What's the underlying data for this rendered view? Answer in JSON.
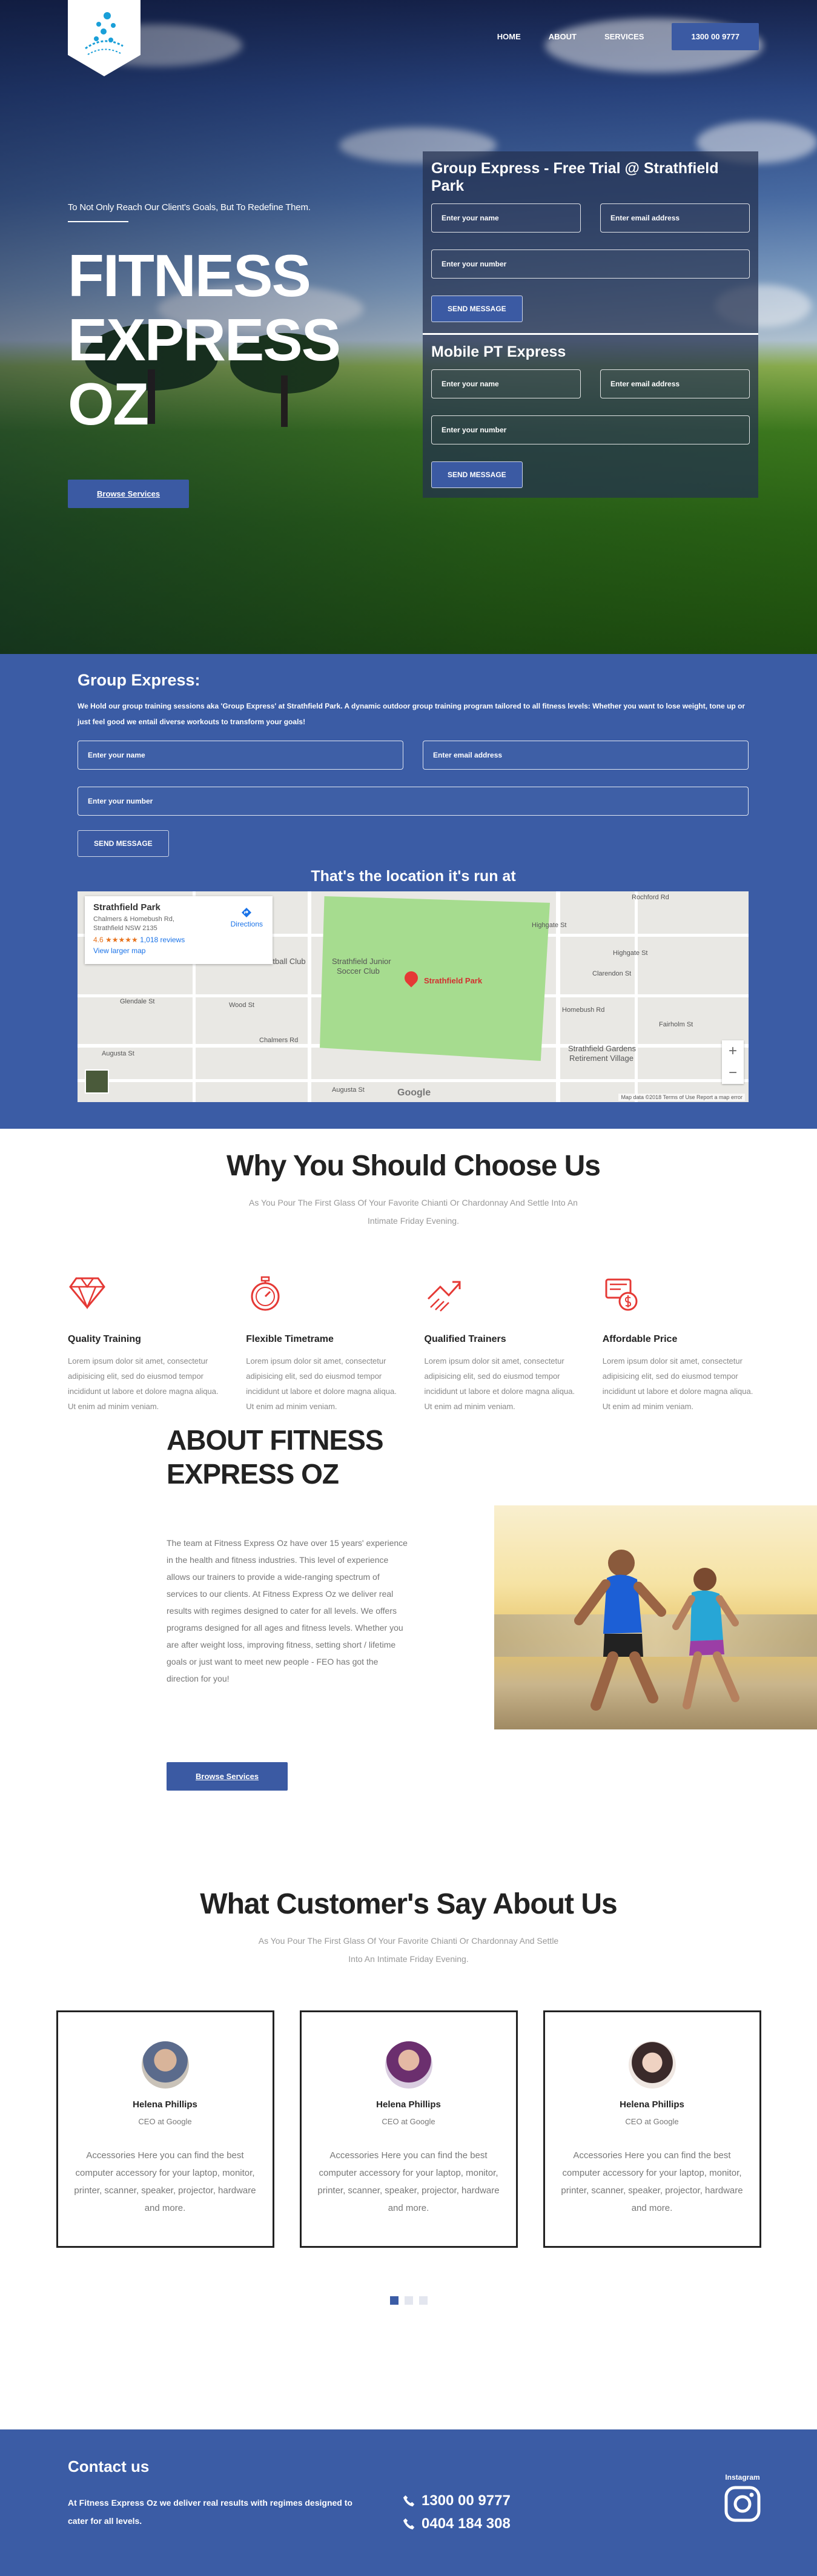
{
  "nav": {
    "home": "HOME",
    "about": "ABOUT",
    "services": "SERVICES",
    "phone": "1300 00 9777"
  },
  "hero": {
    "tagline": "To Not Only Reach Our Client's Goals, But To Redefine Them.",
    "title_line1": "FITNESS",
    "title_line2": "EXPRESS OZ",
    "button": "Browse Services"
  },
  "free_trial_form": {
    "title": "Group Express - Free Trial @ Strathfield Park",
    "name_placeholder": "Enter your name",
    "email_placeholder": "Enter email address",
    "number_placeholder": "Enter your number",
    "submit": "SEND MESSAGE"
  },
  "mobile_pt_form": {
    "title": "Mobile PT Express",
    "name_placeholder": "Enter your name",
    "email_placeholder": "Enter email address",
    "number_placeholder": "Enter your number",
    "submit": "SEND MESSAGE"
  },
  "group_express": {
    "heading": "Group Express:",
    "description": "We Hold our group training sessions aka 'Group Express' at Strathfield Park. A dynamic outdoor group training program tailored to all fitness levels: Whether you want to lose weight, tone up or just feel good we entail diverse workouts to transform your goals!",
    "name_placeholder": "Enter your name",
    "email_placeholder": "Enter email address",
    "number_placeholder": "Enter your number",
    "submit": "SEND MESSAGE",
    "map_title": "That's the location it's run at"
  },
  "map": {
    "place": "Strathfield Park",
    "address_line1": "Chalmers & Homebush Rd,",
    "address_line2": "Strathfield NSW 2135",
    "rating": "4.6 ★★★★★",
    "reviews": "1,018 reviews",
    "larger_map": "View larger map",
    "directions": "Directions",
    "label_club": "Football Club",
    "label_soccer_1": "Strathfield Junior",
    "label_soccer_2": "Soccer Club",
    "label_park": "Strathfield Park",
    "label_village_1": "Strathfield Gardens",
    "label_village_2": "Retirement Village",
    "street_1": "Rochford Rd",
    "street_2": "Highgate St",
    "street_3": "Homebush Rd",
    "street_4": "Augusta St",
    "street_5": "Fairholm St",
    "street_6": "Chalmers Rd",
    "street_7": "Wood St",
    "street_8": "Glendale St",
    "street_9": "Clarendon St",
    "google": "Google",
    "footer": "Map data ©2018   Terms of Use   Report a map error"
  },
  "why": {
    "title": "Why You Should Choose Us",
    "subtitle": "As You Pour The First Glass Of Your Favorite Chianti Or Chardonnay And Settle Into An Intimate Friday Evening.",
    "features": [
      {
        "title": "Quality Training",
        "text": "Lorem ipsum dolor sit amet, consectetur adipisicing elit, sed do eiusmod tempor incididunt ut labore et dolore magna aliqua. Ut enim ad minim veniam."
      },
      {
        "title": "Flexible Timetrame",
        "text": "Lorem ipsum dolor sit amet, consectetur adipisicing elit, sed do eiusmod tempor incididunt ut labore et dolore magna aliqua. Ut enim ad minim veniam."
      },
      {
        "title": "Qualified Trainers",
        "text": "Lorem ipsum dolor sit amet, consectetur adipisicing elit, sed do eiusmod tempor incididunt ut labore et dolore magna aliqua. Ut enim ad minim veniam."
      },
      {
        "title": "Affordable Price",
        "text": "Lorem ipsum dolor sit amet, consectetur adipisicing elit, sed do eiusmod tempor incididunt ut labore et dolore magna aliqua. Ut enim ad minim veniam."
      }
    ]
  },
  "about": {
    "title_line1": "ABOUT FITNESS",
    "title_line2": "EXPRESS OZ",
    "body": "The team at Fitness Express Oz have over 15 years' experience in the health and fitness industries. This level of experience allows our trainers to provide a wide-ranging spectrum of services to our clients. At Fitness Express Oz we deliver real results with regimes designed to cater for all levels. We offers programs designed for all ages and fitness levels. Whether you are after weight loss, improving fitness, setting short / lifetime goals or just want to meet new people - FEO has got the direction for you!",
    "button": "Browse Services"
  },
  "testimonials": {
    "title": "What Customer's Say About Us",
    "subtitle": "As You Pour The First Glass Of Your Favorite Chianti Or Chardonnay And Settle Into An Intimate Friday Evening.",
    "items": [
      {
        "name": "Helena Phillips",
        "role": "CEO at Google",
        "quote": "Accessories Here you can find the best computer accessory for your laptop, monitor, printer, scanner, speaker, projector, hardware and more."
      },
      {
        "name": "Helena Phillips",
        "role": "CEO at Google",
        "quote": "Accessories Here you can find the best computer accessory for your laptop, monitor, printer, scanner, speaker, projector, hardware and more."
      },
      {
        "name": "Helena Phillips",
        "role": "CEO at Google",
        "quote": "Accessories Here you can find the best computer accessory for your laptop, monitor, printer, scanner, speaker, projector, hardware and more."
      }
    ]
  },
  "footer": {
    "heading": "Contact us",
    "text": "At Fitness Express Oz we deliver real results with regimes designed to cater for all levels.",
    "phone1": "1300 00 9777",
    "phone2": "0404 184 308",
    "instagram_label": "Instagram"
  },
  "colors": {
    "brand_blue": "#3b5ca5",
    "accent_red": "#e53935",
    "dark_text": "#222222"
  },
  "icons": [
    "logo-figure-icon",
    "diamond-icon",
    "stopwatch-icon",
    "trainer-arrow-icon",
    "price-tag-icon",
    "phone-icon",
    "instagram-icon",
    "map-pin-icon",
    "directions-icon"
  ]
}
